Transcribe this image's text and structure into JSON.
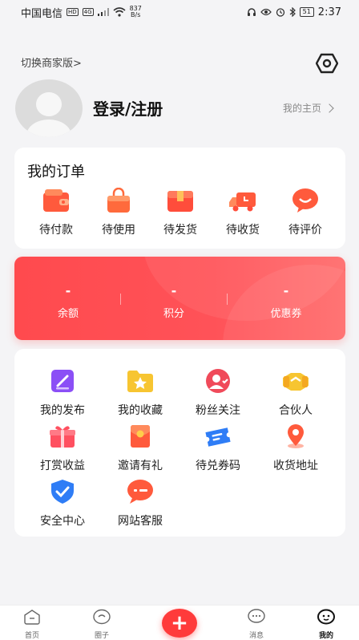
{
  "status_bar": {
    "carrier": "中国电信",
    "hd_tag": "HD",
    "net_tag": "4G",
    "speed_value": "837",
    "speed_unit": "B/s",
    "battery": "51",
    "time": "2:37"
  },
  "header": {
    "switch_merchant": "切换商家版>",
    "login_label": "登录/注册",
    "my_homepage": "我的主页"
  },
  "orders": {
    "title": "我的订单",
    "items": [
      {
        "label": "待付款",
        "icon": "wallet-icon",
        "color": "#ff5a3c"
      },
      {
        "label": "待使用",
        "icon": "shopping-bag-icon",
        "color": "#ff6a3c"
      },
      {
        "label": "待发货",
        "icon": "package-box-icon",
        "color": "#ff4d3b"
      },
      {
        "label": "待收货",
        "icon": "delivery-truck-icon",
        "color": "#ff5a3c"
      },
      {
        "label": "待评价",
        "icon": "comment-bubble-icon",
        "color": "#ff5a3c"
      }
    ]
  },
  "balance": {
    "items": [
      {
        "value": "-",
        "label": "余额"
      },
      {
        "value": "-",
        "label": "积分"
      },
      {
        "value": "-",
        "label": "优惠券"
      }
    ],
    "accent": "#ff4a4e"
  },
  "tools": {
    "items": [
      {
        "label": "我的发布",
        "icon": "edit-post-icon",
        "color": "#8b4ff6"
      },
      {
        "label": "我的收藏",
        "icon": "star-folder-icon",
        "color": "#f7c531"
      },
      {
        "label": "粉丝关注",
        "icon": "fans-user-icon",
        "color": "#f04a5a"
      },
      {
        "label": "合伙人",
        "icon": "handshake-icon",
        "color": "#f7c531"
      },
      {
        "label": "打赏收益",
        "icon": "gift-icon",
        "color": "#ff5060"
      },
      {
        "label": "邀请有礼",
        "icon": "red-envelope-icon",
        "color": "#ff5a3c"
      },
      {
        "label": "待兑券码",
        "icon": "ticket-icon",
        "color": "#2f7df6"
      },
      {
        "label": "收货地址",
        "icon": "location-pin-icon",
        "color": "#ff5a3c"
      },
      {
        "label": "安全中心",
        "icon": "shield-check-icon",
        "color": "#2f7df6"
      },
      {
        "label": "网站客服",
        "icon": "customer-service-icon",
        "color": "#ff5a3c"
      }
    ]
  },
  "tabbar": {
    "items": [
      {
        "label": "首页",
        "icon": "home-icon",
        "active": false
      },
      {
        "label": "圈子",
        "icon": "circle-icon",
        "active": false
      },
      {
        "label": "消息",
        "icon": "message-icon",
        "active": false
      },
      {
        "label": "我的",
        "icon": "profile-icon",
        "active": true
      }
    ],
    "publish_label": "+"
  }
}
